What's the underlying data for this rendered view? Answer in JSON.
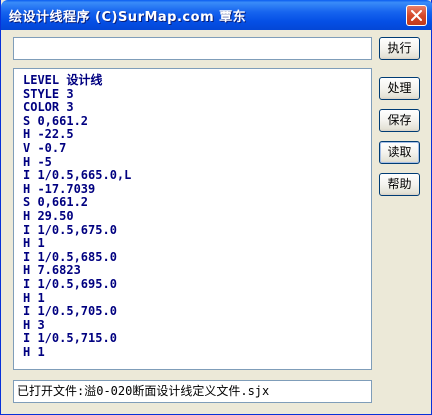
{
  "window": {
    "title": "绘设计线程序 (C)SurMap.com 覃东"
  },
  "toolbar": {
    "execute_label": "执行",
    "process_label": "处理",
    "save_label": "保存",
    "read_label": "读取",
    "help_label": "帮助"
  },
  "command_input": {
    "value": "",
    "placeholder": ""
  },
  "content": {
    "lines": [
      "LEVEL 设计线",
      "STYLE 3",
      "COLOR 3",
      "S 0,661.2",
      "H -22.5",
      "V -0.7",
      "H -5",
      "I 1/0.5,665.0,L",
      "H -17.7039",
      "S 0,661.2",
      "H 29.50",
      "I 1/0.5,675.0",
      "H 1",
      "I 1/0.5,685.0",
      "H 7.6823",
      "I 1/0.5,695.0",
      "H 1",
      "I 1/0.5,705.0",
      "H 3",
      "I 1/0.5,715.0",
      "H 1"
    ]
  },
  "status": {
    "text": "已打开文件:溢0-020断面设计线定义文件.sjx"
  },
  "icons": {
    "close": "close-icon"
  },
  "colors": {
    "titlebar": "#0550e6",
    "content_text": "#000080",
    "window_bg": "#ece9d8"
  }
}
